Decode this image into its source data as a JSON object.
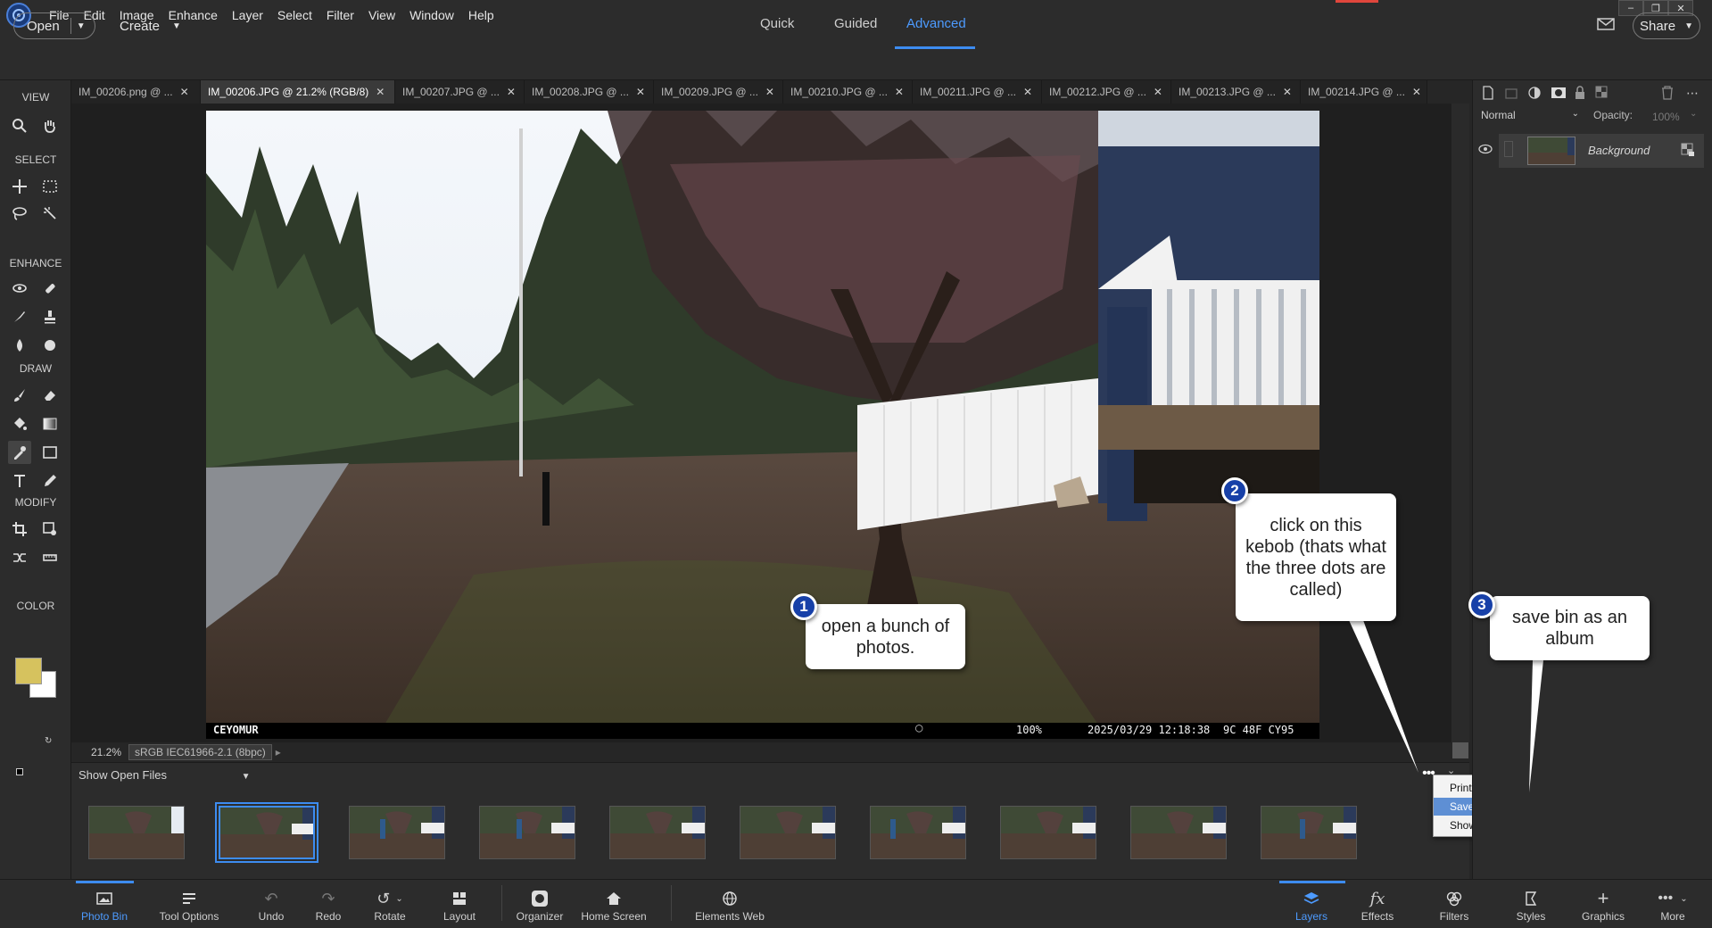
{
  "menubar": {
    "items": [
      "File",
      "Edit",
      "Image",
      "Enhance",
      "Layer",
      "Select",
      "Filter",
      "View",
      "Window",
      "Help"
    ]
  },
  "modebar": {
    "open_label": "Open",
    "create_label": "Create",
    "modes": [
      "Quick",
      "Guided",
      "Advanced"
    ],
    "active_mode": "Advanced",
    "share_label": "Share"
  },
  "toolbar": {
    "sections": [
      "VIEW",
      "SELECT",
      "ENHANCE",
      "DRAW",
      "MODIFY",
      "COLOR"
    ],
    "foreground_color": "#d6c25e",
    "background_color": "#ffffff"
  },
  "tabs": [
    {
      "label": "IM_00206.png @ ...",
      "active": false
    },
    {
      "label": "IM_00206.JPG @ 21.2% (RGB/8)",
      "active": true
    },
    {
      "label": "IM_00207.JPG @ ...",
      "active": false
    },
    {
      "label": "IM_00208.JPG @ ...",
      "active": false
    },
    {
      "label": "IM_00209.JPG @ ...",
      "active": false
    },
    {
      "label": "IM_00210.JPG @ ...",
      "active": false
    },
    {
      "label": "IM_00211.JPG @ ...",
      "active": false
    },
    {
      "label": "IM_00212.JPG @ ...",
      "active": false
    },
    {
      "label": "IM_00213.JPG @ ...",
      "active": false
    },
    {
      "label": "IM_00214.JPG @ ...",
      "active": false
    }
  ],
  "photo": {
    "brand": "CEYOMUR",
    "battery": "100%",
    "timestamp": "2025/03/29 12:18:38",
    "temps": "9C  48F  CY95"
  },
  "status": {
    "zoom": "21.2%",
    "profile": "sRGB IEC61966-2.1 (8bpc)"
  },
  "bin": {
    "show_label": "Show Open Files",
    "thumb_count": 10,
    "selected_index": 1
  },
  "context_menu": {
    "items": [
      "Print Bin Files...",
      "Save Bin as an Album...",
      "Show Grid..."
    ],
    "highlighted_index": 1
  },
  "layers_panel": {
    "blend_mode": "Normal",
    "opacity_label": "Opacity:",
    "opacity_value": "100%",
    "layer_name": "Background"
  },
  "bottombar": {
    "items": [
      "Photo Bin",
      "Tool Options",
      "Undo",
      "Redo",
      "Rotate",
      "Layout",
      "Organizer",
      "Home Screen",
      "Elements Web",
      "Layers",
      "Effects",
      "Filters",
      "Styles",
      "Graphics",
      "More"
    ]
  },
  "callouts": [
    {
      "number": "1",
      "text": "open a bunch of photos."
    },
    {
      "number": "2",
      "text": "click on this kebob (thats what the three dots are called)"
    },
    {
      "number": "3",
      "text": "save bin as an album"
    }
  ]
}
